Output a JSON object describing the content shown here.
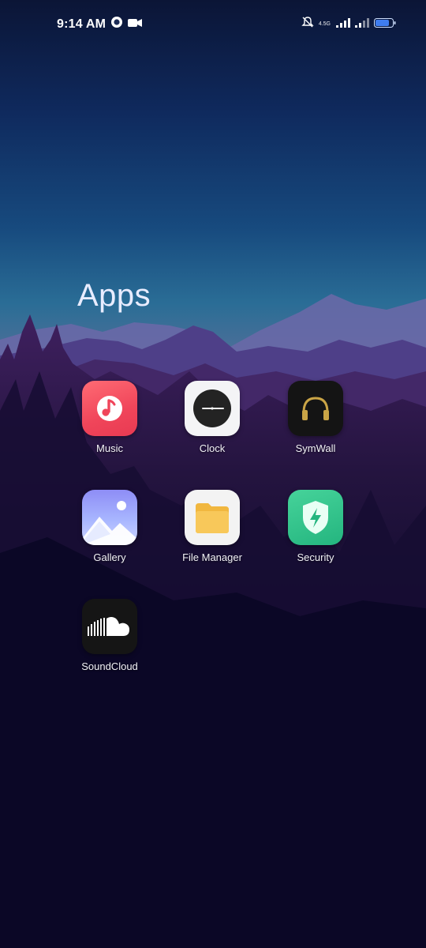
{
  "status_bar": {
    "time": "9:14 AM",
    "network_type": "4.5G",
    "icons": [
      "notification-badge-icon",
      "video-camera-icon",
      "alarm-off-icon",
      "signal-icon",
      "signal-icon",
      "battery-icon"
    ]
  },
  "folder": {
    "title": "Apps",
    "apps": [
      {
        "label": "Music",
        "icon": "music-note-icon"
      },
      {
        "label": "Clock",
        "icon": "clock-icon"
      },
      {
        "label": "SymWall",
        "icon": "headphones-icon"
      },
      {
        "label": "Gallery",
        "icon": "gallery-icon"
      },
      {
        "label": "File Manager",
        "icon": "folder-icon"
      },
      {
        "label": "Security",
        "icon": "shield-icon"
      },
      {
        "label": "SoundCloud",
        "icon": "soundcloud-icon"
      }
    ]
  },
  "colors": {
    "sky_top": "#0c1a44",
    "sky_mid": "#1a5b8c",
    "mountain_purple": "#4a2a74",
    "background_dark": "#0a0724"
  }
}
